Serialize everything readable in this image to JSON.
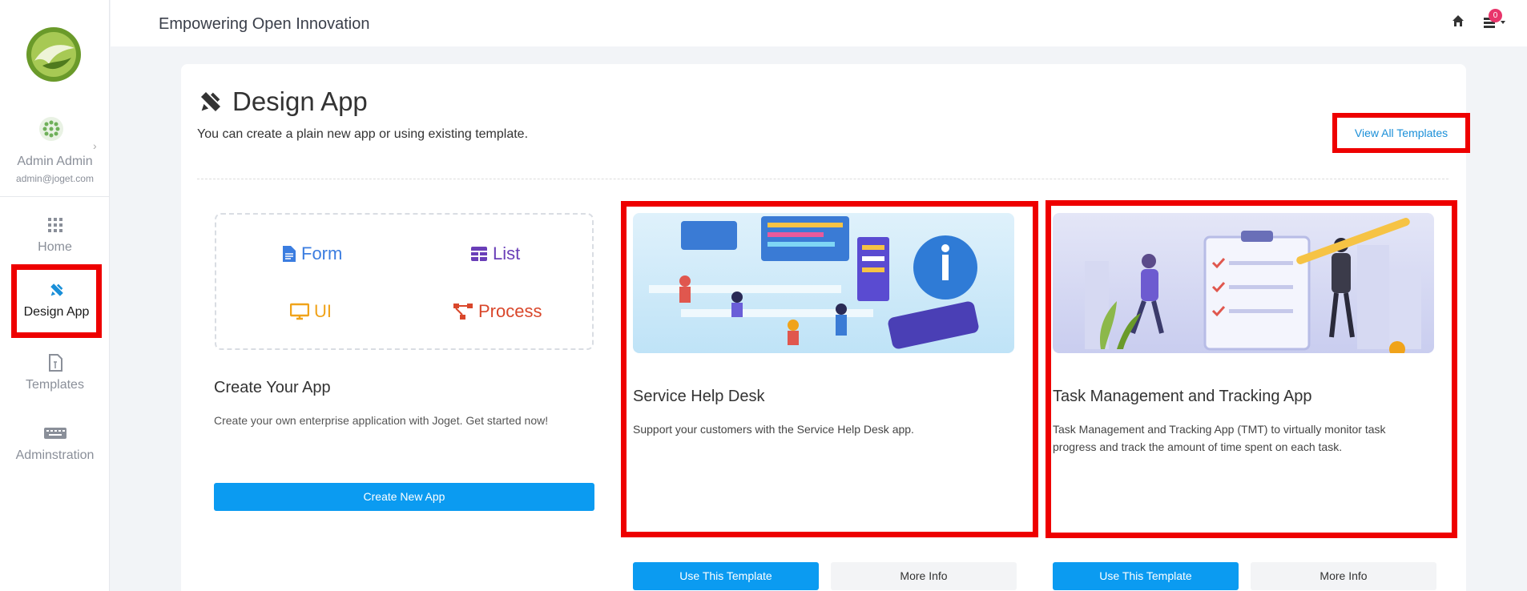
{
  "header": {
    "title": "Empowering Open Innovation",
    "notification_count": "0",
    "home_icon": "home-icon",
    "notification_icon": "inbox-icon"
  },
  "sidebar": {
    "user": {
      "name": "Admin Admin",
      "email": "admin@joget.com"
    },
    "items": [
      {
        "label": "Home",
        "icon": "grid-icon"
      },
      {
        "label": "Design App",
        "icon": "pencil-ruler-icon"
      },
      {
        "label": "Templates",
        "icon": "document-icon"
      },
      {
        "label": "Adminstration",
        "icon": "keyboard-icon"
      }
    ]
  },
  "main": {
    "heading": "Design App",
    "subtitle": "You can create a plain new app or using existing template.",
    "view_all_label": "View All Templates",
    "create": {
      "items": [
        "Form",
        "List",
        "UI",
        "Process"
      ],
      "title": "Create Your App",
      "description": "Create your own enterprise application with Joget. Get started now!",
      "button_label": "Create New App"
    },
    "templates": [
      {
        "title": "Service Help Desk",
        "description": "Support your customers with the Service Help Desk app.",
        "use_label": "Use This Template",
        "more_label": "More Info"
      },
      {
        "title": "Task Management and Tracking App",
        "description": "Task Management and Tracking App (TMT) to virtually monitor task progress and track the amount of time spent on each task.",
        "use_label": "Use This Template",
        "more_label": "More Info"
      }
    ]
  },
  "colors": {
    "accent": "#0b9bf1",
    "highlight": "#ee0000",
    "badge": "#e8356b"
  }
}
